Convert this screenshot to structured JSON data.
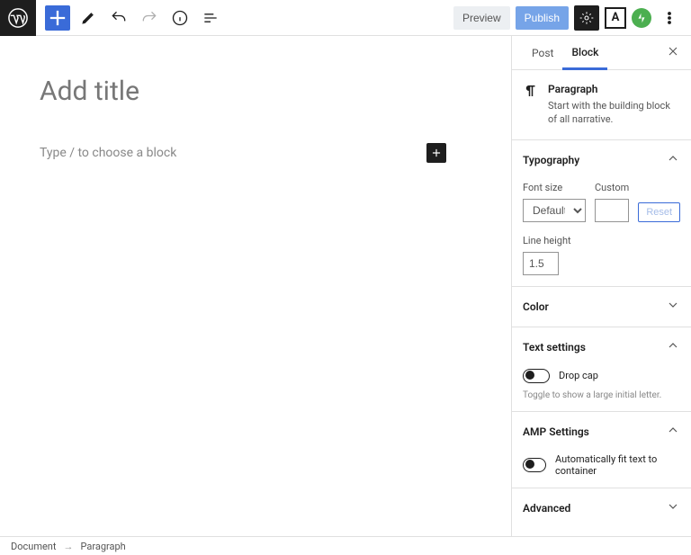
{
  "toolbar": {
    "preview_label": "Preview",
    "publish_label": "Publish",
    "amp_letter": "A"
  },
  "editor": {
    "title_placeholder": "Add title",
    "body_placeholder": "Type / to choose a block"
  },
  "sidebar": {
    "tabs": {
      "post": "Post",
      "block": "Block"
    },
    "block_header": {
      "name": "Paragraph",
      "desc": "Start with the building block of all narrative."
    },
    "typography": {
      "title": "Typography",
      "font_size_label": "Font size",
      "font_size_value": "Default",
      "custom_label": "Custom",
      "reset_label": "Reset",
      "line_height_label": "Line height",
      "line_height_value": "1.5"
    },
    "color": {
      "title": "Color"
    },
    "text_settings": {
      "title": "Text settings",
      "dropcap_label": "Drop cap",
      "hint": "Toggle to show a large initial letter."
    },
    "amp": {
      "title": "AMP Settings",
      "fit_label": "Automatically fit text to container"
    },
    "advanced": {
      "title": "Advanced"
    }
  },
  "breadcrumb": {
    "root": "Document",
    "leaf": "Paragraph"
  }
}
